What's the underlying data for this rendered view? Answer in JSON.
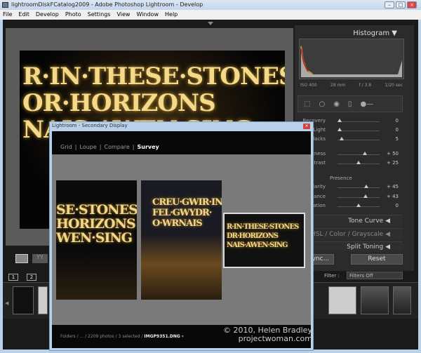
{
  "window": {
    "title": "lightroomDiskFCatalog2009 - Adobe Photoshop Lightroom - Develop",
    "minimize": "–",
    "maximize": "□",
    "close": "×"
  },
  "menu": [
    "File",
    "Edit",
    "Develop",
    "Photo",
    "Settings",
    "View",
    "Window",
    "Help"
  ],
  "photo_text": [
    "R·IN·THESE·STONES",
    "OR·HORIZONS",
    "NAIS·AWEN·SING"
  ],
  "histogram": {
    "title": "Histogram",
    "iso": "ISO 400",
    "focal": "28 mm",
    "aperture": "f / 3.8",
    "shutter": "1/20 sec"
  },
  "sliders": [
    {
      "label": "Recovery",
      "value": "0",
      "pct": 0.05
    },
    {
      "label": "Fill Light",
      "value": "0",
      "pct": 0.05
    },
    {
      "label": "Blacks",
      "value": "5",
      "pct": 0.1
    },
    {
      "label": "Brightness",
      "value": "+ 50",
      "pct": 0.65
    },
    {
      "label": "Contrast",
      "value": "+ 25",
      "pct": 0.5
    },
    {
      "label": "Clarity",
      "value": "+ 45",
      "pct": 0.68
    },
    {
      "label": "Vibrance",
      "value": "+ 43",
      "pct": 0.67
    },
    {
      "label": "Saturation",
      "value": "0",
      "pct": 0.5
    }
  ],
  "presence_label": "Presence",
  "sections": {
    "tone_curve": "Tone Curve",
    "hsl": "HSL  /  Color  /  Grayscale",
    "split_toning": "Split Toning"
  },
  "buttons": {
    "sync": "Sync...",
    "reset": "Reset"
  },
  "filter": {
    "label": "Filter :",
    "value": "Filters Off"
  },
  "filmstrip": {
    "screen1": "1",
    "screen2": "2"
  },
  "secondary": {
    "title": "Lightroom - Secondary Display",
    "close": "×",
    "nav": [
      {
        "label": "Grid",
        "active": false
      },
      {
        "label": "Loupe",
        "active": false
      },
      {
        "label": "Compare",
        "active": false
      },
      {
        "label": "Survey",
        "active": true
      }
    ],
    "sep": "|",
    "path": "Folders / ... / 2209 photos / 3 selected / ",
    "file": "IMGP9351.DNG",
    "photo1_text": [
      "SE·STONES",
      "HORIZONS",
      "WEN·SING"
    ],
    "photo2_text": [
      "CREU·GWIR·INT",
      "FEL·GWYDR·",
      "O·WRNAIS"
    ],
    "photo3_text": [
      "R·IN·THESE·STONES",
      "DR·HORIZONS",
      "NAIS·AWEN·SING"
    ]
  },
  "copyright": [
    "© 2010, Helen Bradley",
    "projectwoman.com"
  ]
}
